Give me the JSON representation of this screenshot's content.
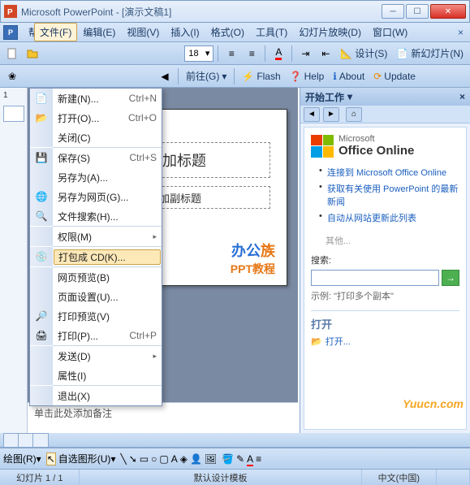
{
  "window": {
    "title": "Microsoft PowerPoint - [演示文稿1]"
  },
  "menubar": {
    "help": "帮",
    "items": [
      "文件(F)",
      "编辑(E)",
      "视图(V)",
      "插入(I)",
      "格式(O)",
      "工具(T)",
      "幻灯片放映(D)",
      "窗口(W)"
    ]
  },
  "file_menu": {
    "items": [
      {
        "label": "新建(N)...",
        "shortcut": "Ctrl+N",
        "icon": "new"
      },
      {
        "label": "打开(O)...",
        "shortcut": "Ctrl+O",
        "icon": "open"
      },
      {
        "label": "关闭(C)",
        "shortcut": "",
        "icon": ""
      },
      {
        "sep": true
      },
      {
        "label": "保存(S)",
        "shortcut": "Ctrl+S",
        "icon": "save"
      },
      {
        "label": "另存为(A)...",
        "shortcut": "",
        "icon": ""
      },
      {
        "label": "另存为网页(G)...",
        "shortcut": "",
        "icon": "saveweb"
      },
      {
        "label": "文件搜索(H)...",
        "shortcut": "",
        "icon": "search"
      },
      {
        "sep": true
      },
      {
        "label": "权限(M)",
        "shortcut": "",
        "icon": "",
        "sub": true
      },
      {
        "sep": true
      },
      {
        "label": "打包成 CD(K)...",
        "shortcut": "",
        "icon": "cd",
        "highlight": true
      },
      {
        "sep": true
      },
      {
        "label": "网页预览(B)",
        "shortcut": "",
        "icon": ""
      },
      {
        "label": "页面设置(U)...",
        "shortcut": "",
        "icon": ""
      },
      {
        "label": "打印预览(V)",
        "shortcut": "",
        "icon": "preview"
      },
      {
        "label": "打印(P)...",
        "shortcut": "Ctrl+P",
        "icon": "print"
      },
      {
        "sep": true
      },
      {
        "label": "发送(D)",
        "shortcut": "",
        "icon": "",
        "sub": true
      },
      {
        "label": "属性(I)",
        "shortcut": "",
        "icon": ""
      },
      {
        "sep": true
      },
      {
        "label": "退出(X)",
        "shortcut": "",
        "icon": ""
      }
    ]
  },
  "toolbar1": {
    "font_size": "18",
    "design_label": "设计(S)",
    "new_slide_label": "新幻灯片(N)"
  },
  "toolbar2": {
    "back_label": "前往(G)",
    "flash_label": "Flash",
    "help_label": "Help",
    "about_label": "About",
    "update_label": "Update"
  },
  "slide": {
    "title_placeholder": "处添加标题",
    "subtitle_placeholder": "处添加副标题",
    "logo1": "办公",
    "logo2": "族",
    "ppt_text": "PPT教程"
  },
  "notes": {
    "placeholder": "单击此处添加备注"
  },
  "taskpane": {
    "title": "开始工作",
    "office_small": "Microsoft",
    "office_brand": "Office Online",
    "links": [
      "连接到 Microsoft Office Online",
      "获取有关使用 PowerPoint 的最新新闻",
      "自动从网站更新此列表"
    ],
    "others": "其他...",
    "search_label": "搜索:",
    "example_label": "示例:",
    "example_text": "\"打印多个副本\"",
    "open_label": "打开",
    "open_link": "打开..."
  },
  "bottom": {
    "draw_label": "绘图(R)",
    "autoshape_label": "自选图形(U)"
  },
  "status": {
    "slide_count": "幻灯片 1 / 1",
    "template": "默认设计模板",
    "lang": "中文(中国)"
  },
  "watermark": "Yuucn.com"
}
